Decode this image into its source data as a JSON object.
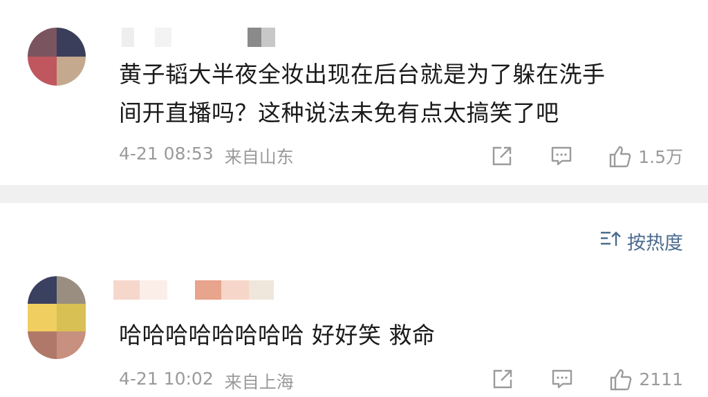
{
  "comments": [
    {
      "content_line1": "黄子韬大半夜全妆出现在后台就是为了躲在洗手",
      "content_line2": "间开直播吗？这种说法未免有点太搞笑了吧",
      "date": "4-21 08:53",
      "location": "来自山东",
      "likes": "1.5万"
    },
    {
      "content_line1": "哈哈哈哈哈哈哈哈 好好笑 救命",
      "date": "4-21 10:02",
      "location": "来自上海",
      "likes": "2111"
    }
  ],
  "sort": {
    "label": "按热度",
    "icon": "sort-icon"
  },
  "icons": {
    "share": "share-icon",
    "comment": "comment-icon",
    "like": "thumbs-up-icon"
  },
  "colors": {
    "text": "#1a1a1a",
    "meta": "#9a9a9a",
    "sort_accent": "#4a6a8e",
    "divider": "#f0f0f0"
  }
}
